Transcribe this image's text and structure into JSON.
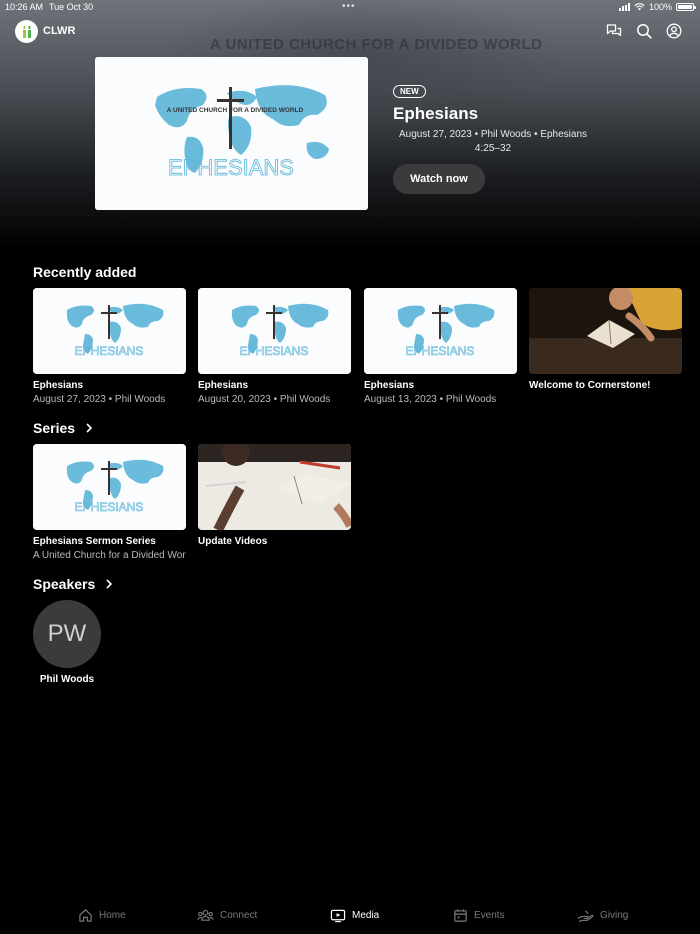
{
  "status_bar": {
    "time": "10:26 AM",
    "date": "Tue Oct 30",
    "battery": "100%"
  },
  "app": {
    "name": "CLWR"
  },
  "hero": {
    "background_text": "A UNITED CHURCH FOR A DIVIDED WORLD",
    "thumb_caption": "A UNITED CHURCH FOR A DIVIDED WORLD",
    "thumb_word": "EPHESIANS",
    "badge": "NEW",
    "title": "Ephesians",
    "meta": "August 27, 2023 • Phil Woods • Ephesians 4:25–32",
    "watch_label": "Watch now"
  },
  "recently_added": {
    "heading": "Recently added",
    "items": [
      {
        "title": "Ephesians",
        "subtitle": "August 27, 2023 • Phil Woods"
      },
      {
        "title": "Ephesians",
        "subtitle": "August 20, 2023 • Phil Woods"
      },
      {
        "title": "Ephesians",
        "subtitle": "August 13, 2023 • Phil Woods"
      },
      {
        "title": "Welcome to Cornerstone!",
        "subtitle": ""
      }
    ]
  },
  "series": {
    "heading": "Series",
    "items": [
      {
        "title": "Ephesians Sermon Series",
        "subtitle": "A United Church for a Divided World"
      },
      {
        "title": "Update Videos",
        "subtitle": ""
      }
    ]
  },
  "speakers": {
    "heading": "Speakers",
    "items": [
      {
        "initials": "PW",
        "name": "Phil Woods"
      }
    ]
  },
  "tabs": [
    {
      "label": "Home",
      "icon": "home-icon",
      "active": false
    },
    {
      "label": "Connect",
      "icon": "people-icon",
      "active": false
    },
    {
      "label": "Media",
      "icon": "play-screen-icon",
      "active": true
    },
    {
      "label": "Events",
      "icon": "calendar-icon",
      "active": false
    },
    {
      "label": "Giving",
      "icon": "giving-hand-icon",
      "active": false
    }
  ],
  "colors": {
    "background": "#000000",
    "button": "#3b3b3d",
    "map_blue": "#5bb5d8",
    "inactive_tab": "#7a7a7a"
  }
}
